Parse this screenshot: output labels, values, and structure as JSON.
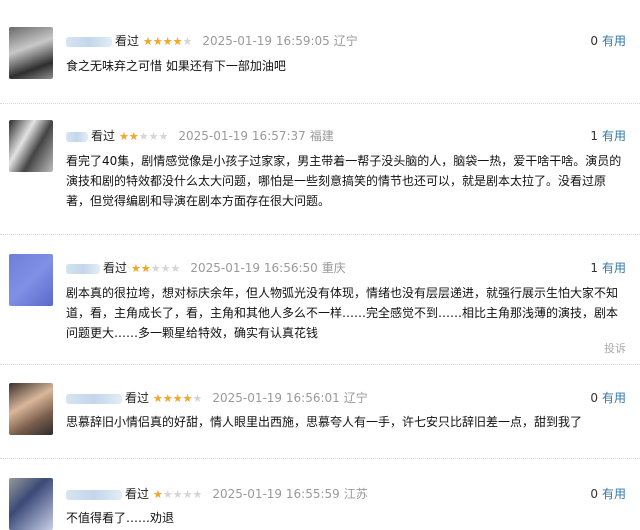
{
  "comments": [
    {
      "status": "看过",
      "rating": 4,
      "time": "2025-01-19 16:59:05",
      "location": "辽宁",
      "useful_count": "0",
      "useful_label": "有用",
      "text": "食之无味弃之可惜 如果还有下一部加油吧"
    },
    {
      "status": "看过",
      "rating": 2,
      "time": "2025-01-19 16:57:37",
      "location": "福建",
      "useful_count": "1",
      "useful_label": "有用",
      "text": "看完了40集，剧情感觉像是小孩子过家家，男主带着一帮子没头脑的人，脑袋一热，爱干啥干啥。演员的演技和剧的特效都没什么太大问题，哪怕是一些刻意搞笑的情节也还可以，就是剧本太拉了。没看过原著，但觉得编剧和导演在剧本方面存在很大问题。"
    },
    {
      "status": "看过",
      "rating": 2,
      "time": "2025-01-19 16:56:50",
      "location": "重庆",
      "useful_count": "1",
      "useful_label": "有用",
      "text": "剧本真的很拉垮，想对标庆余年，但人物弧光没有体现，情绪也没有层层递进，就强行展示生怕大家不知道，看，主角成长了，看，主角和其他人多么不一样……完全感觉不到……相比主角那浅薄的演技，剧本问题更大……多一颗星给特效，确实有认真花钱",
      "report_label": "投诉"
    },
    {
      "status": "看过",
      "rating": 4,
      "time": "2025-01-19 16:56:01",
      "location": "辽宁",
      "useful_count": "0",
      "useful_label": "有用",
      "text": "思慕辞旧小情侣真的好甜，情人眼里出西施，思慕夸人有一手，许七安只比辞旧差一点，甜到我了"
    },
    {
      "status": "看过",
      "rating": 1,
      "time": "2025-01-19 16:55:59",
      "location": "江苏",
      "useful_count": "0",
      "useful_label": "有用",
      "text": "不值得看了……劝退"
    }
  ],
  "colors": {
    "star": "#f5a623",
    "star_empty": "#d5d5d5",
    "useful_link": "#3377aa",
    "meta_gray": "#9a9a9a"
  }
}
